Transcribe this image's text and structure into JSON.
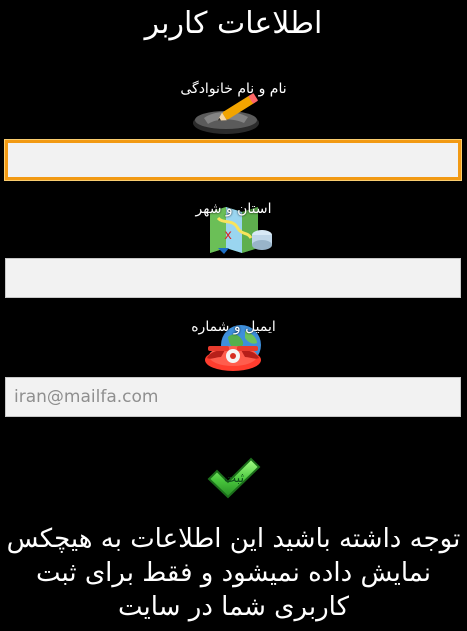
{
  "header": {
    "title": "اطلاعات کاربر"
  },
  "form": {
    "full_name_label": "نام و نام خانوادگی",
    "city_label": "استان و شهر",
    "email_label": "ایمیل و شماره",
    "full_name_value": "",
    "city_value": "",
    "email_value": "",
    "email_placeholder": "iran@mailfa.com"
  },
  "actions": {
    "submit_label": "ثبت"
  },
  "notice": {
    "text": "توجه داشته باشید این اطلاعات به هیچکس نمایش داده نمیشود و فقط برای ثبت کاربری شما در سایت"
  },
  "icons": {
    "name": "pen-icon",
    "city": "map-icon",
    "email": "phone-globe-icon",
    "submit": "check-icon"
  },
  "colors": {
    "background": "#000000",
    "text": "#ffffff",
    "input_background": "#f2f2f2",
    "focus_border": "#f29a14",
    "submit_green": "#45c63b"
  }
}
